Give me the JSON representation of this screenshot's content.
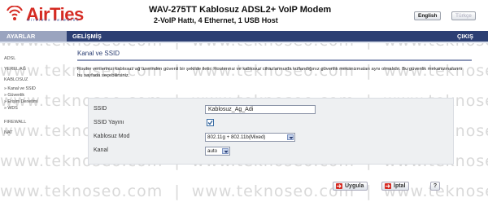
{
  "header": {
    "logo": "AirTies",
    "logo_tagline": "wireless networks",
    "model_title": "WAV-275TT Kablosuz ADSL2+ VoIP Modem",
    "model_subtitle": "2-VoIP Hattı, 4 Ethernet, 1 USB Host",
    "lang_english": "English",
    "lang_turkish": "Türkçe"
  },
  "nav": {
    "settings": "AYARLAR",
    "advanced": "GELİŞMİŞ",
    "logout": "ÇIKIŞ"
  },
  "sidebar": {
    "items": [
      "ADSL",
      "YEREL AĞ",
      "KABLOSUZ",
      "» Kanal ve SSID",
      "» Güvenlik",
      "» Erişim Denetimi",
      "» WDS",
      "FIREWALL",
      "NAT"
    ]
  },
  "page": {
    "title": "Kanal ve SSID",
    "description": "Router verilerinizi kablosuz ağ üzerinden güvenli bir şekilde iletir. Routerınız ve kablosuz cihazlarınızda kullandığınız güvenlik mekanizmaları aynı olmalıdır. Bu güvenlik mekanizmalarını bu sayfada seçebilirsiniz."
  },
  "form": {
    "ssid_label": "SSID",
    "ssid_value": "Kablosuz_Ag_Adi",
    "broadcast_label": "SSID Yayını",
    "broadcast_checked": true,
    "mode_label": "Kablosuz Mod",
    "mode_value": "802.11g + 802.11b(Mixed)",
    "channel_label": "Kanal",
    "channel_value": "auto"
  },
  "buttons": {
    "apply": "Uygula",
    "cancel": "İptal",
    "help": "?"
  },
  "watermark": "www.teknoseo.com",
  "colors": {
    "brand_red": "#d52a22",
    "nav_blue": "#2c3f73",
    "active_tab": "#9aa4bf"
  }
}
